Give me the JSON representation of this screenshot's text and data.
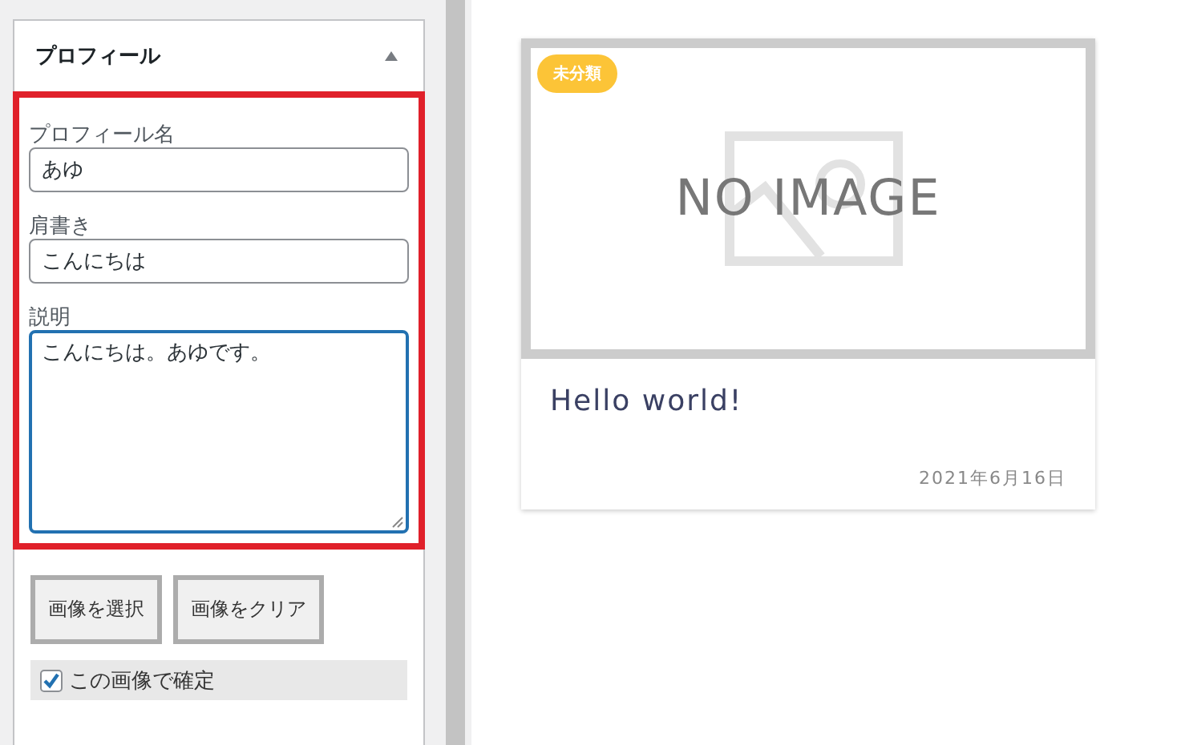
{
  "panel": {
    "title": "プロフィール",
    "expanded": true,
    "fields": [
      {
        "label": "プロフィール名",
        "value": "あゆ",
        "kind": "input"
      },
      {
        "label": "肩書き",
        "value": "こんにちは",
        "kind": "input"
      },
      {
        "label": "説明",
        "value": "こんにちは。あゆです。",
        "kind": "textarea"
      }
    ],
    "buttons": [
      "画像を選択",
      "画像をクリア"
    ],
    "confirm": {
      "label": "この画像で確定",
      "checked": true
    }
  },
  "post": {
    "category": "未分類",
    "image_text": "NO IMAGE",
    "title": "Hello world!",
    "date": "2021年6月16日"
  }
}
